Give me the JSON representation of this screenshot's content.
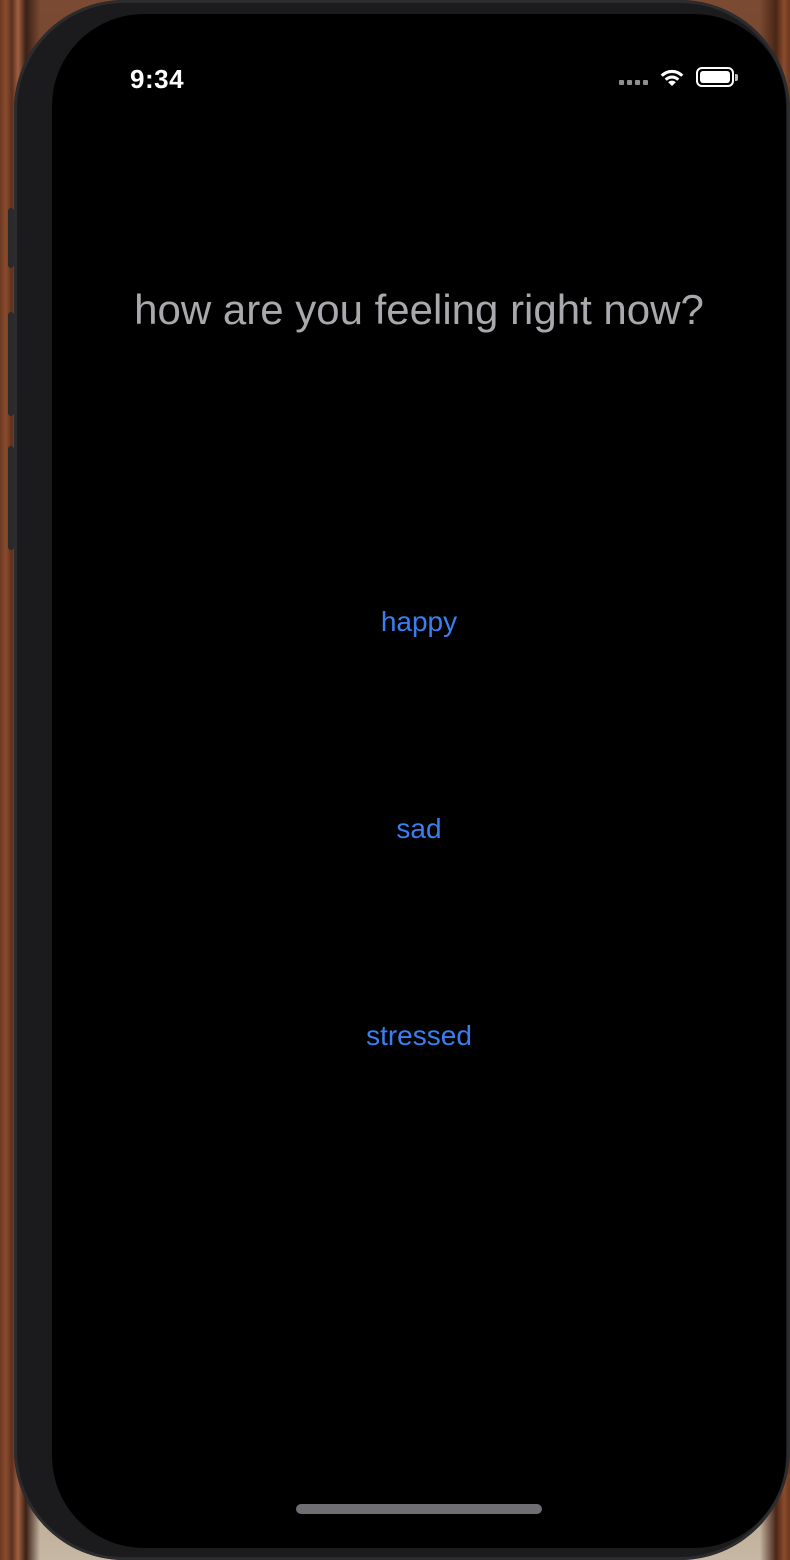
{
  "status_bar": {
    "time": "9:34",
    "battery_level": 1.0
  },
  "screen": {
    "question": "how are you feeling right now?",
    "moods": [
      {
        "label": "happy"
      },
      {
        "label": "sad"
      },
      {
        "label": "stressed"
      }
    ]
  },
  "colors": {
    "background": "#000000",
    "question_text": "#a8a8ad",
    "accent": "#3a7ff2"
  },
  "icons": [
    "cellular-signal-icon",
    "wifi-icon",
    "battery-icon"
  ]
}
